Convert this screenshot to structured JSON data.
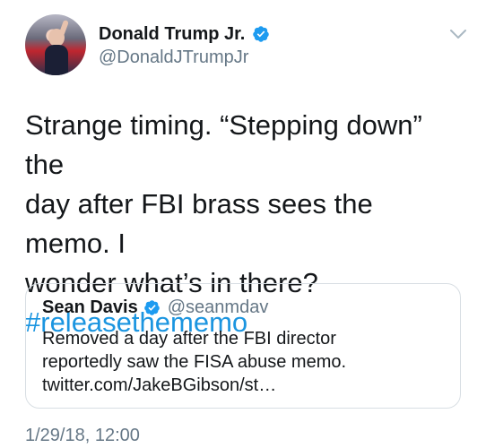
{
  "tweet": {
    "author_name": "Donald Trump Jr.",
    "author_handle": "@DonaldJTrumpJr",
    "text_lines": [
      "Strange timing. “Stepping down” the",
      "day after FBI brass sees the memo. I",
      "wonder what’s in there?"
    ],
    "hashtag": "#releasethememo",
    "timestamp": "1/29/18, 12:00"
  },
  "quoted_tweet": {
    "author_name": "Sean Davis",
    "author_handle": "@seanmdav",
    "text_lines": [
      "Removed a day after the FBI director",
      "reportedly saw the FISA abuse memo.",
      "twitter.com/JakeBGibson/st…"
    ]
  },
  "colors": {
    "verified_blue": "#1d9bf0",
    "hashtag_blue": "#1b95e0",
    "secondary_text": "#657786",
    "primary_text": "#14171a",
    "border": "#d8dee3"
  },
  "icons": {
    "verified": "verified-badge-icon",
    "menu": "chevron-down-icon"
  }
}
